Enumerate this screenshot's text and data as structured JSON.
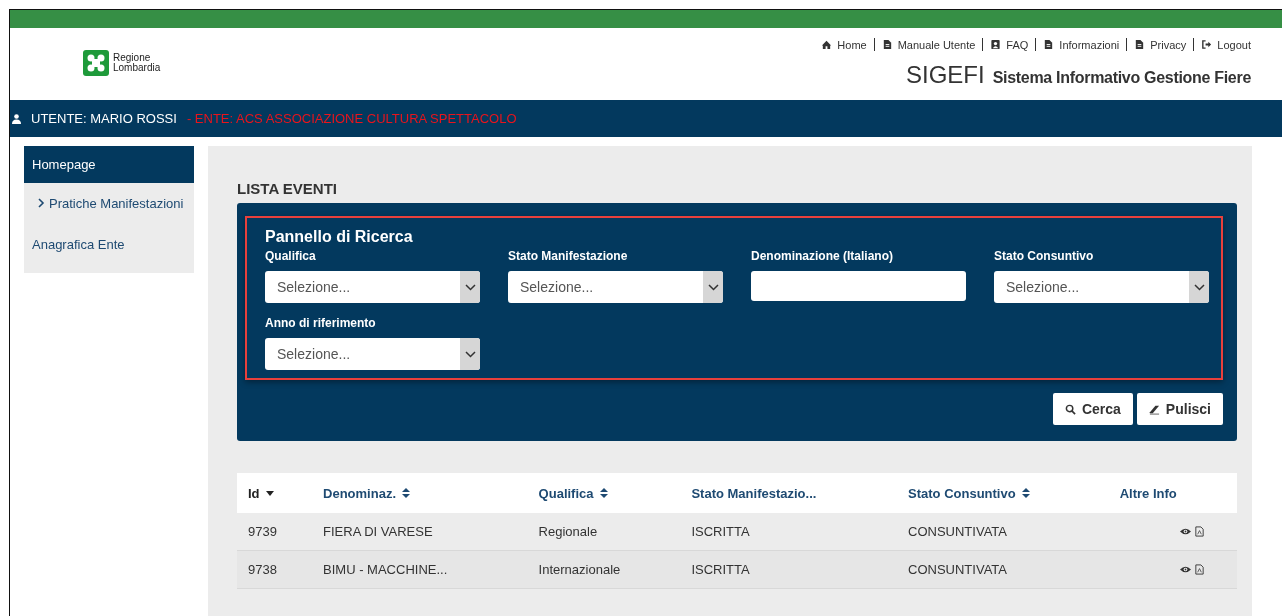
{
  "header": {
    "logo_text": "Regione\nLombardia",
    "links": [
      {
        "label": "Home"
      },
      {
        "label": "Manuale Utente"
      },
      {
        "label": "FAQ"
      },
      {
        "label": "Informazioni"
      },
      {
        "label": "Privacy"
      },
      {
        "label": "Logout"
      }
    ],
    "app_name": "SIGEFI",
    "app_subtitle": "Sistema Informativo Gestione Fiere"
  },
  "user_bar": {
    "user": "UTENTE: MARIO ROSSI",
    "entity": "- ENTE: ACS ASSOCIAZIONE CULTURA SPETTACOLO"
  },
  "sidebar": {
    "items": [
      {
        "label": "Homepage",
        "selected": true,
        "kind": "link"
      },
      {
        "label": "Pratiche Manifestazioni",
        "selected": false,
        "kind": "submenu"
      },
      {
        "label": "Anagrafica Ente",
        "selected": false,
        "kind": "link"
      }
    ]
  },
  "page_title": "LISTA EVENTI",
  "search_panel": {
    "title": "Pannello di Ricerca",
    "fields": [
      {
        "label": "Qualifica",
        "kind": "select",
        "placeholder": "Selezione..."
      },
      {
        "label": "Stato Manifestazione",
        "kind": "select",
        "placeholder": "Selezione..."
      },
      {
        "label": "Denominazione (Italiano)",
        "kind": "text"
      },
      {
        "label": "Stato Consuntivo",
        "kind": "select",
        "placeholder": "Selezione..."
      },
      {
        "label": "Anno di riferimento",
        "kind": "select",
        "placeholder": "Selezione..."
      }
    ],
    "buttons": [
      {
        "label": "Cerca"
      },
      {
        "label": "Pulisci"
      }
    ]
  },
  "table": {
    "columns": [
      {
        "label": "Id",
        "kind": "sorted"
      },
      {
        "label": "Denominaz.",
        "kind": "sortable"
      },
      {
        "label": "Qualifica",
        "kind": "sortable"
      },
      {
        "label": "Stato Manifestazio...",
        "kind": "plain"
      },
      {
        "label": "Stato Consuntivo",
        "kind": "sortable"
      },
      {
        "label": "Altre Info",
        "kind": "plain"
      }
    ],
    "rows": [
      {
        "cells": [
          "9739",
          "FIERA DI VARESE",
          "Regionale",
          "ISCRITTA",
          "CONSUNTIVATA"
        ]
      },
      {
        "cells": [
          "9738",
          "BIMU - MACCHINE...",
          "Internazionale",
          "ISCRITTA",
          "CONSUNTIVATA"
        ]
      }
    ]
  }
}
